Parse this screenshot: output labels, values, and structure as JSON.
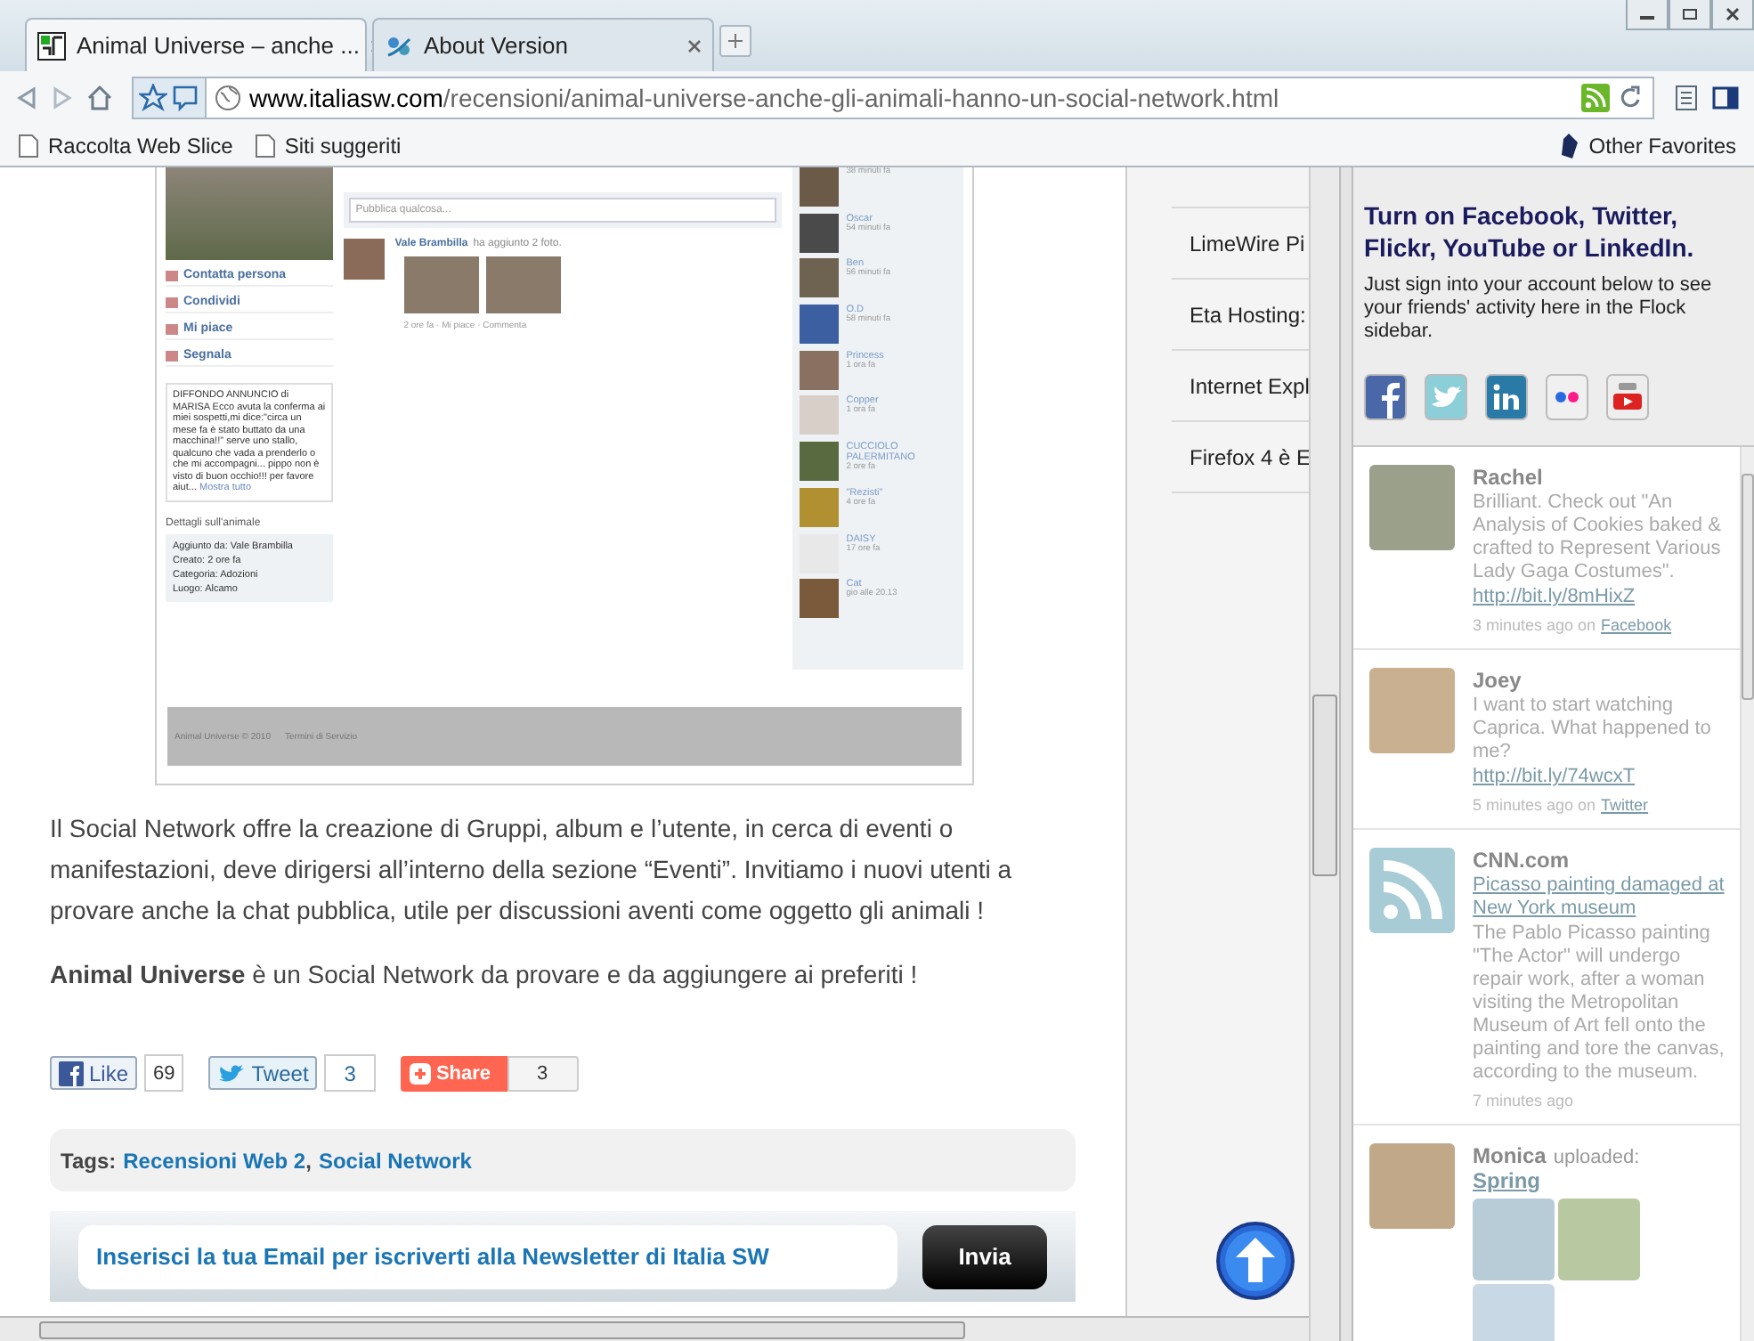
{
  "window": {
    "tabs": [
      {
        "title": "Animal Universe – anche ...",
        "selected": true,
        "kind": "site"
      },
      {
        "title": "About Version",
        "selected": false,
        "kind": "about"
      }
    ]
  },
  "toolbar": {
    "url_domain": "www.italiasw.com",
    "url_path": "/recensioni/animal-universe-anche-gli-animali-hanno-un-social-network.html"
  },
  "bookmarks": {
    "items": [
      "Raccolta Web Slice",
      "Siti suggeriti"
    ],
    "other": "Other Favorites"
  },
  "page": {
    "embedded_screenshot": {
      "menu": [
        {
          "label": "Contatta persona"
        },
        {
          "label": "Condividi"
        },
        {
          "label": "Mi piace"
        },
        {
          "label": "Segnala"
        }
      ],
      "note": "DIFFONDO ANNUNCIO di MARISA Ecco avuta la conferma ai miei sospetti,mi dice:\"circa un mese fa è stato buttato da una macchina!!\" serve uno stallo, qualcuno che vada a prenderlo o che mi accompagni... pippo non è visto di buon occhio!!! per favore aiut...",
      "note_more": "Mostra tutto",
      "details_title": "Dettagli sull'animale",
      "details": [
        {
          "label": "Aggiunto da:",
          "value": "Vale Brambilla"
        },
        {
          "label": "Creato:",
          "value": "2 ore fa"
        },
        {
          "label": "Categoria:",
          "value": "Adozioni"
        },
        {
          "label": "Luogo:",
          "value": "Alcamo"
        }
      ],
      "composer_placeholder": "Pubblica qualcosa...",
      "post": {
        "author": "Vale Brambilla",
        "action": "ha aggiunto 2 foto.",
        "meta": "2 ore fa · Mi piace · Commenta"
      },
      "friends": [
        {
          "time": "38 minuti fa"
        },
        {
          "name": "Oscar",
          "time": "54 minuti fa"
        },
        {
          "name": "Ben",
          "time": "56 minuti fa"
        },
        {
          "name": "O.D",
          "time": "58 minuti fa"
        },
        {
          "name": "Princess",
          "time": "1 ora fa"
        },
        {
          "name": "Copper",
          "time": "1 ora fa"
        },
        {
          "name": "CUCCIOLO PALERMITANO",
          "time": "2 ore fa"
        },
        {
          "name": "\"Rezisti\"",
          "time": "4 ore fa"
        },
        {
          "name": "DAISY",
          "time": "17 ore fa"
        },
        {
          "name": "Cat",
          "time": "gio alle 20.13"
        }
      ],
      "footer": [
        "Animal Universe © 2010",
        "Termini di Servizio"
      ]
    },
    "article_links": [
      "LimeWire Pi",
      "Eta Hosting:",
      "Internet Expl",
      "Firefox 4 è E"
    ],
    "paragraphs": [
      "Il Social Network offre la creazione di Gruppi, album e  l’utente, in cerca di eventi o manifestazioni, deve dirigersi all’interno della sezione “Eventi”. Invitiamo i nuovi utenti a provare anche la chat pubblica, utile per discussioni aventi come oggetto gli animali !",
      "**Animal Universe** è un Social Network da provare e da aggiungere ai preferiti !"
    ],
    "share": [
      {
        "kind": "like",
        "label": "Like",
        "count": "69"
      },
      {
        "kind": "tweet",
        "label": "Tweet",
        "count": "3"
      },
      {
        "kind": "share",
        "label": "Share",
        "count": "3"
      }
    ],
    "tags": {
      "label": "Tags:",
      "items": [
        "Recensioni Web 2",
        "Social Network"
      ],
      "separator": ","
    },
    "newsletter": {
      "placeholder": "Inserisci la tua Email per iscriverti alla Newsletter di Italia SW",
      "button": "Invia"
    }
  },
  "sidebar": {
    "heading": "Turn on Facebook, Twitter, Flickr, YouTube or LinkedIn.",
    "text": "Just sign into your account below to see your friends' activity here in the Flock sidebar.",
    "feed": [
      {
        "kind": "status",
        "name": "Rachel",
        "text": "Brilliant. Check out \"An Analysis of Cookies baked & crafted to Represent Various Lady Gaga Costumes\".",
        "link": "http://bit.ly/8mHixZ",
        "time": "3 minutes ago on",
        "source": "Facebook"
      },
      {
        "kind": "status",
        "name": "Joey",
        "text": "I want to start watching Caprica. What happened to me?",
        "link": "http://bit.ly/74wcxT",
        "time": "5 minutes ago on",
        "source": "Twitter"
      },
      {
        "kind": "news",
        "name": "CNN.com",
        "link": "Picasso painting damaged at New York museum",
        "text": "The Pablo Picasso painting \"The Actor\" will undergo repair work, after a woman visiting the Metropolitan Museum of Art fell onto the painting and tore the canvas, according to the museum.",
        "time": "7 minutes ago"
      },
      {
        "kind": "photos",
        "name": "Monica",
        "action": "uploaded:",
        "link": "Spring"
      }
    ]
  }
}
